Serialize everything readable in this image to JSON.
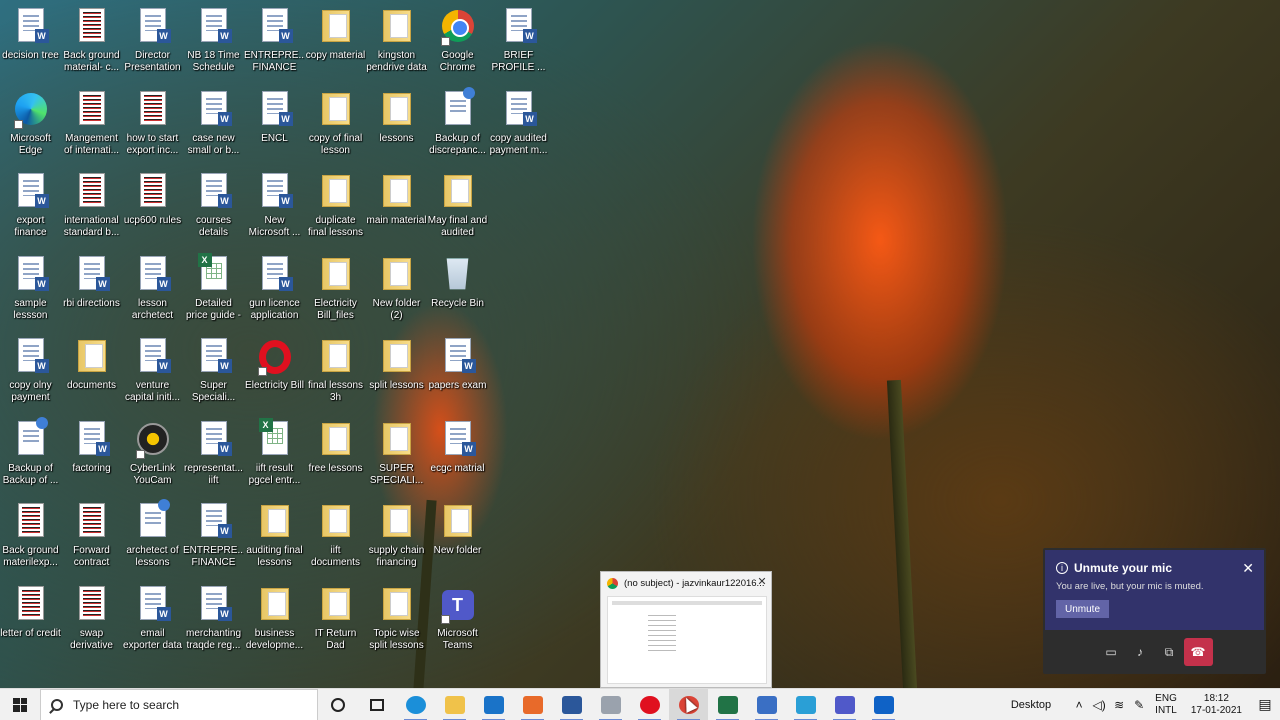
{
  "desktop": {
    "icons": [
      {
        "label": "decision tree",
        "type": "doc"
      },
      {
        "label": "Back ground material- c...",
        "type": "pdf"
      },
      {
        "label": "Director Presentation",
        "type": "doc"
      },
      {
        "label": "NB 18 Time Schedule",
        "type": "doc"
      },
      {
        "label": "ENTREPRE... FINANCE",
        "type": "doc"
      },
      {
        "label": "copy material",
        "type": "folder"
      },
      {
        "label": "kingston pendrive data",
        "type": "folder"
      },
      {
        "label": "Google Chrome",
        "type": "chrome"
      },
      {
        "label": "BRIEF PROFILE ...",
        "type": "doc"
      },
      {
        "label": "Microsoft Edge",
        "type": "edge"
      },
      {
        "label": "Mangement of internati...",
        "type": "pdf"
      },
      {
        "label": "how to start export inc...",
        "type": "pdf"
      },
      {
        "label": "case new small or b...",
        "type": "doc"
      },
      {
        "label": "ENCL",
        "type": "doc"
      },
      {
        "label": "copy of final lesson",
        "type": "folder"
      },
      {
        "label": "lessons",
        "type": "folder"
      },
      {
        "label": "Backup of discrepanc...",
        "type": "backup"
      },
      {
        "label": "copy audited payment m...",
        "type": "doc"
      },
      {
        "label": "export finance",
        "type": "doc"
      },
      {
        "label": "international standard b...",
        "type": "pdf"
      },
      {
        "label": "ucp600 rules",
        "type": "pdf"
      },
      {
        "label": "courses details",
        "type": "doc"
      },
      {
        "label": "New Microsoft ...",
        "type": "doc"
      },
      {
        "label": "duplicate final lessons",
        "type": "folder"
      },
      {
        "label": "main material",
        "type": "folder"
      },
      {
        "label": "May final and audited less...",
        "type": "folder"
      },
      {
        "label": "sample lessson",
        "type": "doc"
      },
      {
        "label": "rbi directions",
        "type": "doc"
      },
      {
        "label": "lesson archetect",
        "type": "doc"
      },
      {
        "label": "Detailed price guide - Vati...",
        "type": "xls"
      },
      {
        "label": "gun licence application",
        "type": "doc"
      },
      {
        "label": "Electricity Bill_files",
        "type": "folder"
      },
      {
        "label": "New folder (2)",
        "type": "folder"
      },
      {
        "label": "Recycle Bin",
        "type": "bin"
      },
      {
        "label": "copy olny payment",
        "type": "doc"
      },
      {
        "label": "documents",
        "type": "folder"
      },
      {
        "label": "venture capital initi...",
        "type": "doc"
      },
      {
        "label": "Super Speciali...",
        "type": "doc"
      },
      {
        "label": "Electricity Bill",
        "type": "opera"
      },
      {
        "label": "final lessons 3h",
        "type": "folder"
      },
      {
        "label": "split lessons",
        "type": "folder"
      },
      {
        "label": "papers exam",
        "type": "doc"
      },
      {
        "label": "Backup of Backup of ...",
        "type": "backup"
      },
      {
        "label": "factoring",
        "type": "doc"
      },
      {
        "label": "CyberLink YouCam",
        "type": "cyber"
      },
      {
        "label": "representat... iift",
        "type": "doc"
      },
      {
        "label": "iift result pgcel entr...",
        "type": "xls"
      },
      {
        "label": "free lessons",
        "type": "folder"
      },
      {
        "label": "SUPER SPECIALI...",
        "type": "folder"
      },
      {
        "label": "ecgc matrial",
        "type": "doc"
      },
      {
        "label": "Back ground materilexp...",
        "type": "pdf"
      },
      {
        "label": "Forward contract",
        "type": "pdf"
      },
      {
        "label": "archetect of lessons",
        "type": "backup"
      },
      {
        "label": "ENTREPRE... FINANCE FI...",
        "type": "doc"
      },
      {
        "label": "auditing final lessons",
        "type": "folder"
      },
      {
        "label": "iift documents",
        "type": "folder"
      },
      {
        "label": "supply chain financing",
        "type": "folder"
      },
      {
        "label": "New folder",
        "type": "folder"
      },
      {
        "label": "letter of credit",
        "type": "pdf"
      },
      {
        "label": "swap derivative",
        "type": "pdf"
      },
      {
        "label": "email exporter data",
        "type": "doc"
      },
      {
        "label": "merchanting traqde reg...",
        "type": "doc"
      },
      {
        "label": "business developme...",
        "type": "folder"
      },
      {
        "label": "IT Return Dad",
        "type": "folder"
      },
      {
        "label": "Topic wise split lessons",
        "type": "folder"
      },
      {
        "label": "Microsoft Teams",
        "type": "teams"
      }
    ]
  },
  "taskbar": {
    "search_placeholder": "Type here to search",
    "apps": [
      {
        "name": "edge",
        "color": "#1b8fd9"
      },
      {
        "name": "file-explorer",
        "color": "#f0c24a"
      },
      {
        "name": "mail",
        "color": "#1a73c8"
      },
      {
        "name": "office",
        "color": "#e86a2a"
      },
      {
        "name": "word-doc",
        "color": "#2b579a"
      },
      {
        "name": "tools",
        "color": "#9aa2ad"
      },
      {
        "name": "opera",
        "color": "#e0101f"
      },
      {
        "name": "chrome",
        "color": "#db4437"
      },
      {
        "name": "excel",
        "color": "#217346"
      },
      {
        "name": "remote-desktop",
        "color": "#3a6fc4"
      },
      {
        "name": "wps",
        "color": "#2a9fd6"
      },
      {
        "name": "teams",
        "color": "#5059c9"
      },
      {
        "name": "outlook",
        "color": "#0f62c6"
      }
    ],
    "tray": {
      "desktop_label": "Desktop",
      "lang_top": "ENG",
      "lang_bottom": "INTL",
      "time": "18:12",
      "date": "17-01-2021"
    }
  },
  "thumbnail": {
    "title": "(no subject) - jazvinkaur122016..."
  },
  "toast": {
    "title": "Unmute your mic",
    "message": "You are live, but your mic is muted.",
    "button": "Unmute"
  }
}
